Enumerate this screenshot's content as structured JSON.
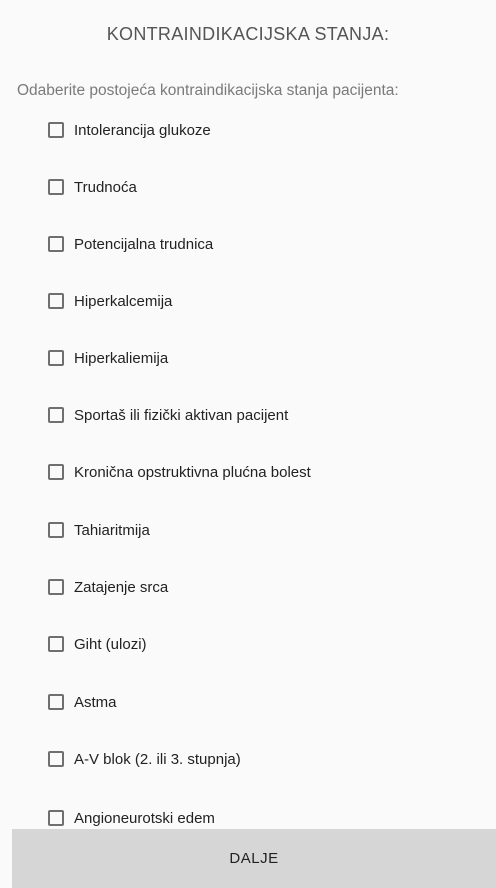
{
  "header": {
    "title": "KONTRAINDIKACIJSKA STANJA:",
    "subtitle": "Odaberite postojeća kontraindikacijska stanja pacijenta:"
  },
  "conditions": [
    {
      "label": "Intolerancija glukoze",
      "checked": false
    },
    {
      "label": "Trudnoća",
      "checked": false
    },
    {
      "label": "Potencijalna trudnica",
      "checked": false
    },
    {
      "label": "Hiperkalcemija",
      "checked": false
    },
    {
      "label": "Hiperkaliemija",
      "checked": false
    },
    {
      "label": "Sportaš ili fizički aktivan pacijent",
      "checked": false
    },
    {
      "label": "Kronična opstruktivna plućna bolest",
      "checked": false
    },
    {
      "label": "Tahiaritmija",
      "checked": false
    },
    {
      "label": "Zatajenje srca",
      "checked": false
    },
    {
      "label": "Giht (ulozi)",
      "checked": false
    },
    {
      "label": "Astma",
      "checked": false
    },
    {
      "label": "A-V blok (2. ili 3. stupnja)",
      "checked": false
    },
    {
      "label": "Angioneurotski edem",
      "checked": false
    }
  ],
  "footer": {
    "button_label": "DALJE"
  }
}
